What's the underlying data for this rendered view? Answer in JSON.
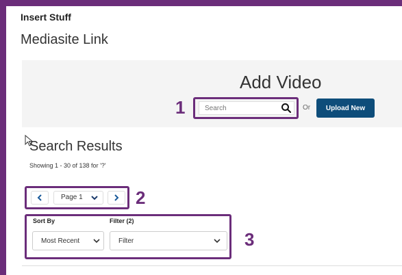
{
  "header": {
    "title": "Insert Stuff",
    "subtitle": "Mediasite Link"
  },
  "add_video": {
    "title": "Add Video",
    "search": {
      "placeholder": "Search",
      "icon": "search-icon"
    },
    "or_label": "Or",
    "upload_label": "Upload New"
  },
  "results": {
    "title": "Search Results",
    "showing": "Showing 1 - 30 of 138 for '?'"
  },
  "pager": {
    "prev_icon": "chevron-left-icon",
    "page_value": "Page 1",
    "next_icon": "chevron-right-icon"
  },
  "sort": {
    "label": "Sort By",
    "value": "Most Recent"
  },
  "filter": {
    "label": "Filter (2)",
    "value": "Filter"
  },
  "callouts": {
    "one": "1",
    "two": "2",
    "three": "3"
  },
  "colors": {
    "frame": "#6b2d7a",
    "callout": "#6b2d7a",
    "upload_button": "#0e4d7a",
    "pager_arrow": "#1a5a9a"
  }
}
